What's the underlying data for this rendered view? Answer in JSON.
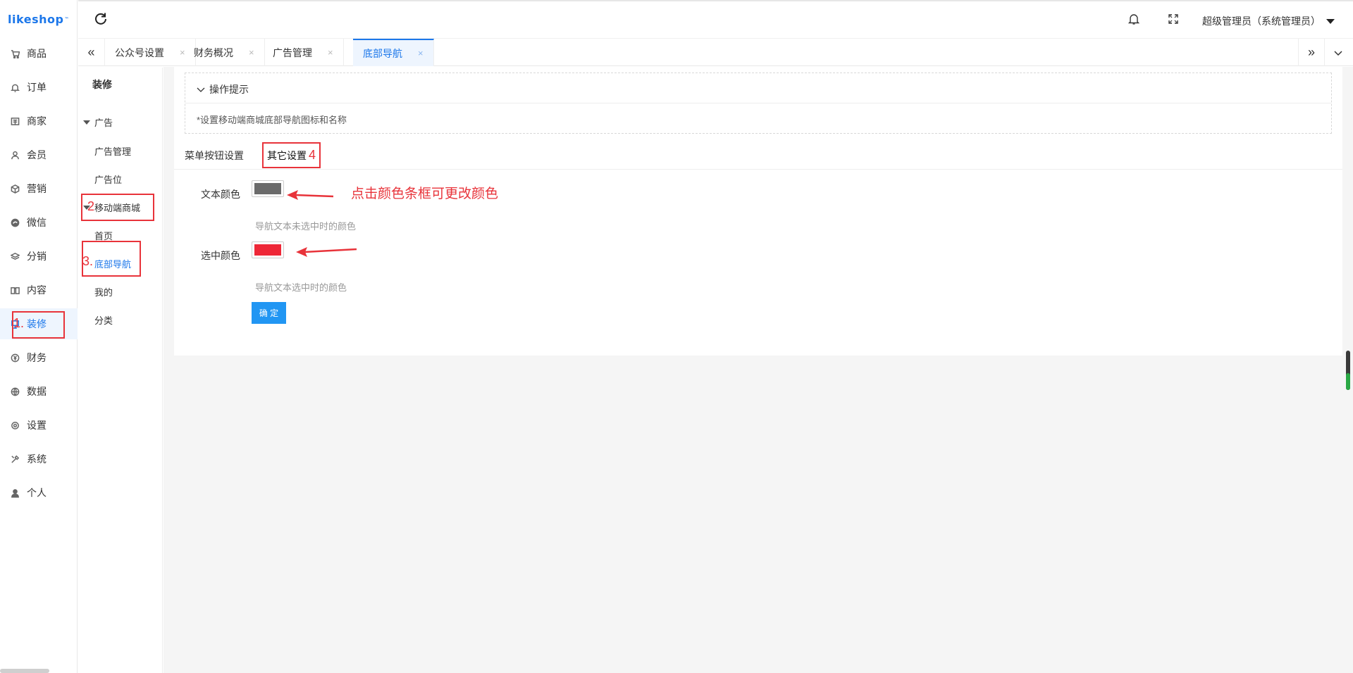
{
  "app": {
    "logo": "likeshop",
    "logo_tm": "™"
  },
  "sidebar": {
    "items": [
      {
        "label": "商品",
        "icon": "cart-icon"
      },
      {
        "label": "订单",
        "icon": "bell-icon"
      },
      {
        "label": "商家",
        "icon": "shop-icon"
      },
      {
        "label": "会员",
        "icon": "user-icon"
      },
      {
        "label": "营销",
        "icon": "cube-icon"
      },
      {
        "label": "微信",
        "icon": "wechat-icon"
      },
      {
        "label": "分销",
        "icon": "layers-icon"
      },
      {
        "label": "内容",
        "icon": "book-icon"
      },
      {
        "label": "装修",
        "icon": "decorate-icon"
      },
      {
        "label": "财务",
        "icon": "yen-icon"
      },
      {
        "label": "数据",
        "icon": "globe-icon"
      },
      {
        "label": "设置",
        "icon": "gear-icon"
      },
      {
        "label": "系统",
        "icon": "tools-icon"
      },
      {
        "label": "个人",
        "icon": "person-icon"
      }
    ],
    "active_index": 8
  },
  "subsidebar": {
    "title": "装修",
    "groups": [
      {
        "label": "广告",
        "items": [
          "广告管理",
          "广告位"
        ]
      },
      {
        "label": "移动端商城",
        "items": [
          "首页",
          "底部导航",
          "我的",
          "分类"
        ]
      }
    ],
    "active_item": "底部导航"
  },
  "header": {
    "user": "超级管理员（系统管理员）"
  },
  "tabs": {
    "items": [
      {
        "label": "公众号设置",
        "close": "×"
      },
      {
        "label": "财务概况",
        "close": "×"
      },
      {
        "label": "广告管理",
        "close": "×"
      },
      {
        "label": "底部导航",
        "close": "×"
      }
    ],
    "active_index": 3
  },
  "tip": {
    "title": "操作提示",
    "body": "*设置移动端商城底部导航图标和名称"
  },
  "content_tabs": {
    "tab1": "菜单按钮设置",
    "tab2": "其它设置"
  },
  "form": {
    "text_color_label": "文本颜色",
    "text_color_value": "#6b6b6b",
    "text_color_hint": "导航文本未选中时的颜色",
    "selected_color_label": "选中颜色",
    "selected_color_value": "#ee2737",
    "selected_color_hint": "导航文本选中时的颜色",
    "submit": "确 定"
  },
  "annotations": {
    "n1": "1.",
    "n2": "2",
    "n3": "3.",
    "n4": "4",
    "note": "点击颜色条框可更改颜色"
  },
  "colors": {
    "accent": "#1c77ea",
    "button": "#2196f3",
    "annotation": "#e8333a"
  }
}
